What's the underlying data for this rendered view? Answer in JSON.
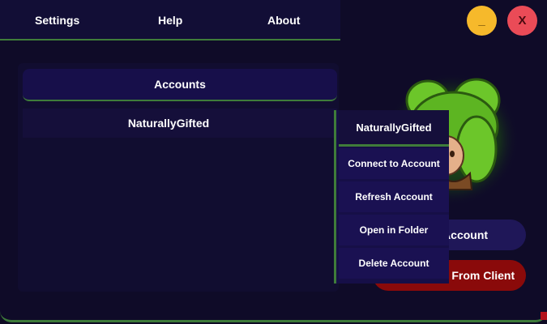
{
  "menu": {
    "settings": "Settings",
    "help": "Help",
    "about": "About"
  },
  "window_controls": {
    "minimize_label": "_",
    "close_label": "X",
    "minimize_color": "#f6b92b",
    "close_color": "#ea4b57"
  },
  "accounts": {
    "header": "Accounts",
    "items": [
      {
        "name": "NaturallyGifted"
      }
    ]
  },
  "avatar": {
    "icon": "green-haired-character-avatar"
  },
  "actions": {
    "save_label": "Save Account",
    "disconnect_label": "Disconnect From Client"
  },
  "context_menu": {
    "title": "NaturallyGifted",
    "items": [
      "Connect to Account",
      "Refresh Account",
      "Open in Folder",
      "Delete Account"
    ]
  },
  "colors": {
    "accent_green": "#3f7c3a",
    "background": "#0f0b28",
    "danger": "#8a0a0a"
  }
}
